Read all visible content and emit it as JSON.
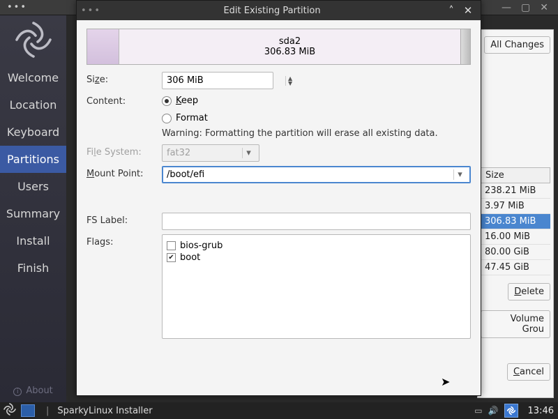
{
  "titlebar": {
    "title": "Edit Existing Partition"
  },
  "sidebar": {
    "items": [
      "Welcome",
      "Location",
      "Keyboard",
      "Partitions",
      "Users",
      "Summary",
      "Install",
      "Finish"
    ],
    "active_index": 3,
    "about": "About"
  },
  "partition_bar": {
    "name": "sda2",
    "size": "306.83 MiB"
  },
  "form": {
    "size_label": "Size:",
    "size_value": "306 MiB",
    "content_label": "Content:",
    "keep_label": "Keep",
    "format_label": "Format",
    "warning": "Warning: Formatting the partition will erase all existing data.",
    "filesystem_label": "File System:",
    "filesystem_value": "fat32",
    "mountpoint_label": "Mount Point:",
    "mountpoint_value": "/boot/efi",
    "fslabel_label": "FS Label:",
    "fslabel_value": "",
    "flags_label": "Flags:",
    "flags": [
      {
        "name": "bios-grub",
        "checked": false
      },
      {
        "name": "boot",
        "checked": true
      }
    ]
  },
  "bg_panel": {
    "all_changes_btn": "All Changes",
    "size_header": "Size",
    "sizes": [
      "238.21 MiB",
      "3.97 MiB",
      "306.83 MiB",
      "16.00 MiB",
      "80.00 GiB",
      "47.45 GiB"
    ],
    "selected_index": 2,
    "delete_btn": "Delete",
    "volume_group_btn": "Volume Grou",
    "cancel_btn": "Cancel"
  },
  "taskbar": {
    "task_label": "SparkyLinux Installer",
    "clock": "13:46"
  }
}
